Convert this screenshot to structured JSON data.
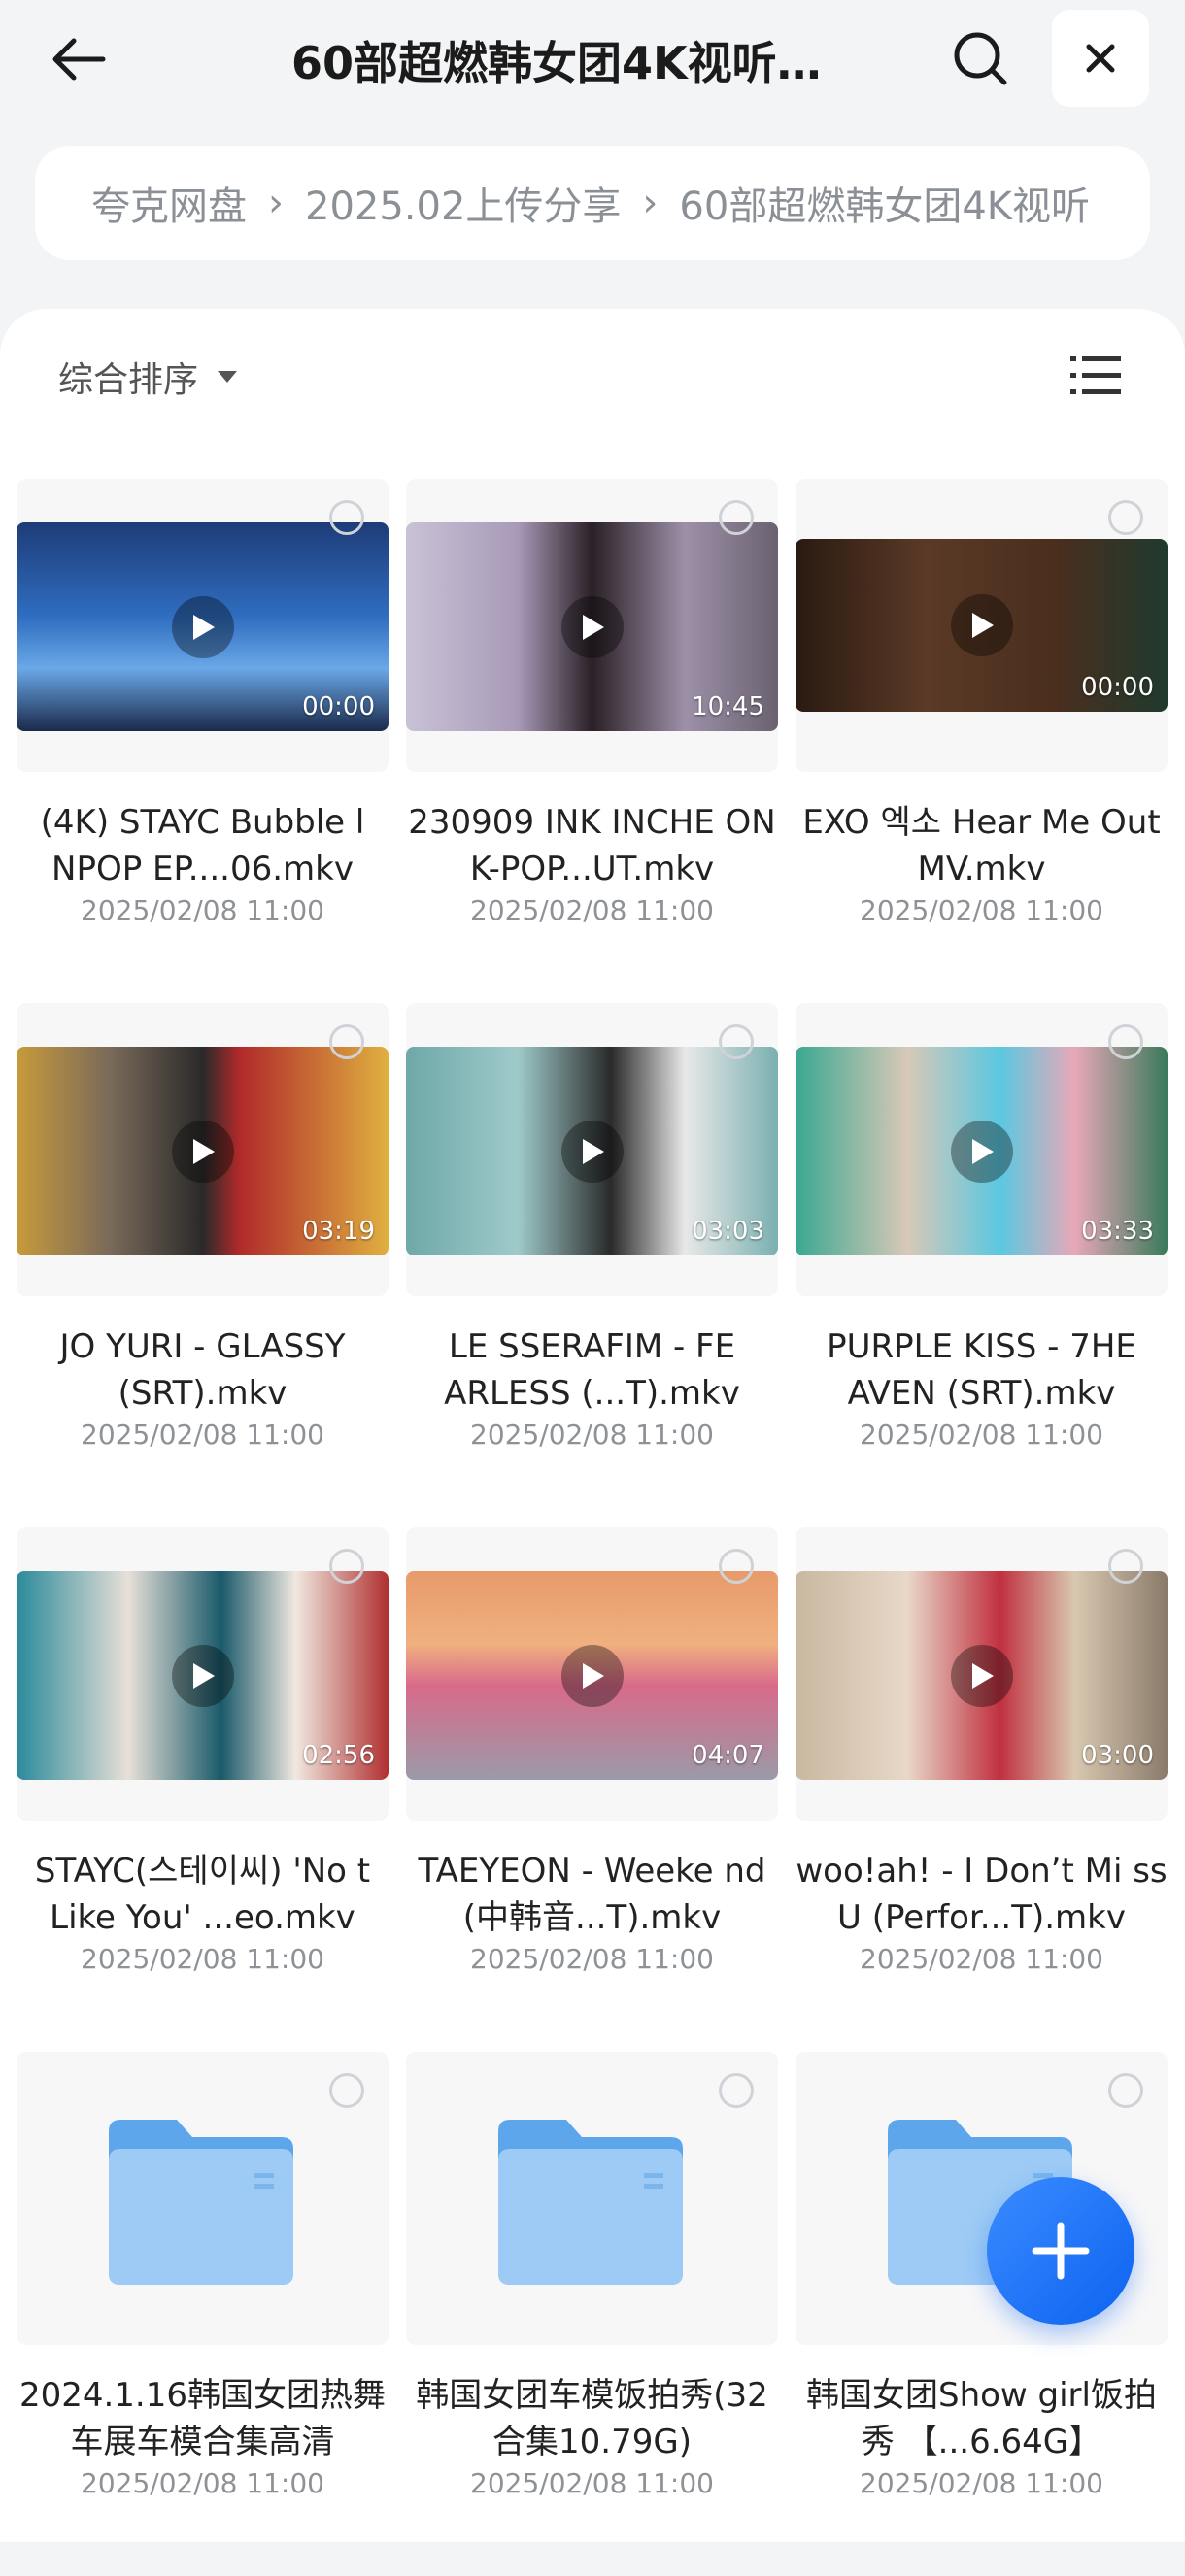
{
  "header": {
    "title": "60部超燃韩女团4K视听…",
    "back_icon": "arrow-left-icon",
    "search_icon": "search-icon",
    "close_icon": "close-icon"
  },
  "breadcrumb": {
    "items": [
      "夸克网盘",
      "2025.02上传分享",
      "60部超燃韩女团4K视听"
    ]
  },
  "toolbar": {
    "sort_label": "综合排序",
    "view_icon": "list-view-icon"
  },
  "files": [
    {
      "type": "video",
      "name": "(4K) STAYC Bubble l NPOP EP....06.mkv",
      "date": "2025/02/08 11:00",
      "duration": "00:00"
    },
    {
      "type": "video",
      "name": "230909 INK INCHE ON K-POP...UT.mkv",
      "date": "2025/02/08 11:00",
      "duration": "10:45"
    },
    {
      "type": "video",
      "name": "EXO 엑소 Hear Me Out MV.mkv",
      "date": "2025/02/08 11:00",
      "duration": "00:00"
    },
    {
      "type": "video",
      "name": "JO YURI - GLASSY (SRT).mkv",
      "date": "2025/02/08 11:00",
      "duration": "03:19"
    },
    {
      "type": "video",
      "name": "LE SSERAFIM - FE ARLESS (...T).mkv",
      "date": "2025/02/08 11:00",
      "duration": "03:03"
    },
    {
      "type": "video",
      "name": "PURPLE KISS - 7HE AVEN (SRT).mkv",
      "date": "2025/02/08 11:00",
      "duration": "03:33"
    },
    {
      "type": "video",
      "name": "STAYC(스테이씨) 'No t Like You' ...eo.mkv",
      "date": "2025/02/08 11:00",
      "duration": "02:56"
    },
    {
      "type": "video",
      "name": "TAEYEON - Weeke nd (中韩音...T).mkv",
      "date": "2025/02/08 11:00",
      "duration": "04:07"
    },
    {
      "type": "video",
      "name": "woo!ah! - I Don’t Mi ss U (Perfor...T).mkv",
      "date": "2025/02/08 11:00",
      "duration": "03:00"
    },
    {
      "type": "folder",
      "name": "2024.1.16韩国女团热舞车展车模合集高清",
      "date": "2025/02/08 11:00"
    },
    {
      "type": "folder",
      "name": "韩国女团车模饭拍秀(32合集10.79G)",
      "date": "2025/02/08 11:00"
    },
    {
      "type": "folder",
      "name": "韩国女团Show girl饭拍秀 【...6.64G】",
      "date": "2025/02/08 11:00"
    }
  ],
  "fab": {
    "icon": "plus-icon"
  },
  "colors": {
    "accent": "#1a6ff5",
    "folder": "#6fb2f2",
    "background": "#f3f4f6"
  }
}
